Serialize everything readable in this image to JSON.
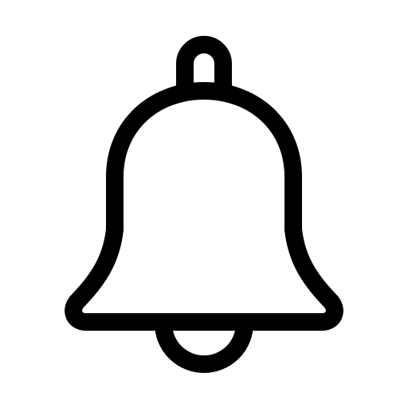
{
  "icon": {
    "name": "bell-icon",
    "stroke_color": "#000000",
    "fill_color": "#ffffff",
    "background_color": "#ffffff"
  }
}
